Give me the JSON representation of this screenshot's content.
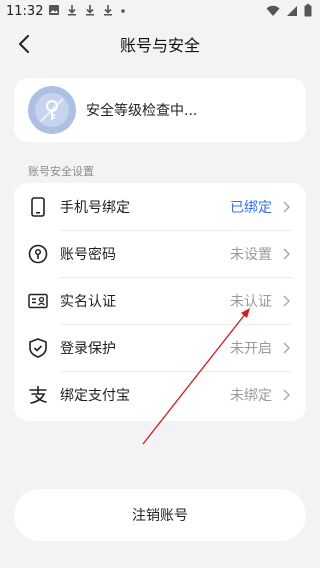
{
  "statusbar": {
    "time": "11:32"
  },
  "header": {
    "title": "账号与安全"
  },
  "security": {
    "text": "安全等级检查中..."
  },
  "section": {
    "label": "账号安全设置"
  },
  "rows": [
    {
      "label": "手机号绑定",
      "value": "已绑定",
      "icon": "phone-icon"
    },
    {
      "label": "账号密码",
      "value": "未设置",
      "icon": "keyhole-icon"
    },
    {
      "label": "实名认证",
      "value": "未认证",
      "icon": "id-card-icon"
    },
    {
      "label": "登录保护",
      "value": "未开启",
      "icon": "shield-check-icon"
    },
    {
      "label": "绑定支付宝",
      "value": "未绑定",
      "icon": "alipay-icon"
    }
  ],
  "footer": {
    "logout_label": "注销账号"
  },
  "colors": {
    "accent": "#3471e6",
    "annotation": "#d11a1a"
  }
}
